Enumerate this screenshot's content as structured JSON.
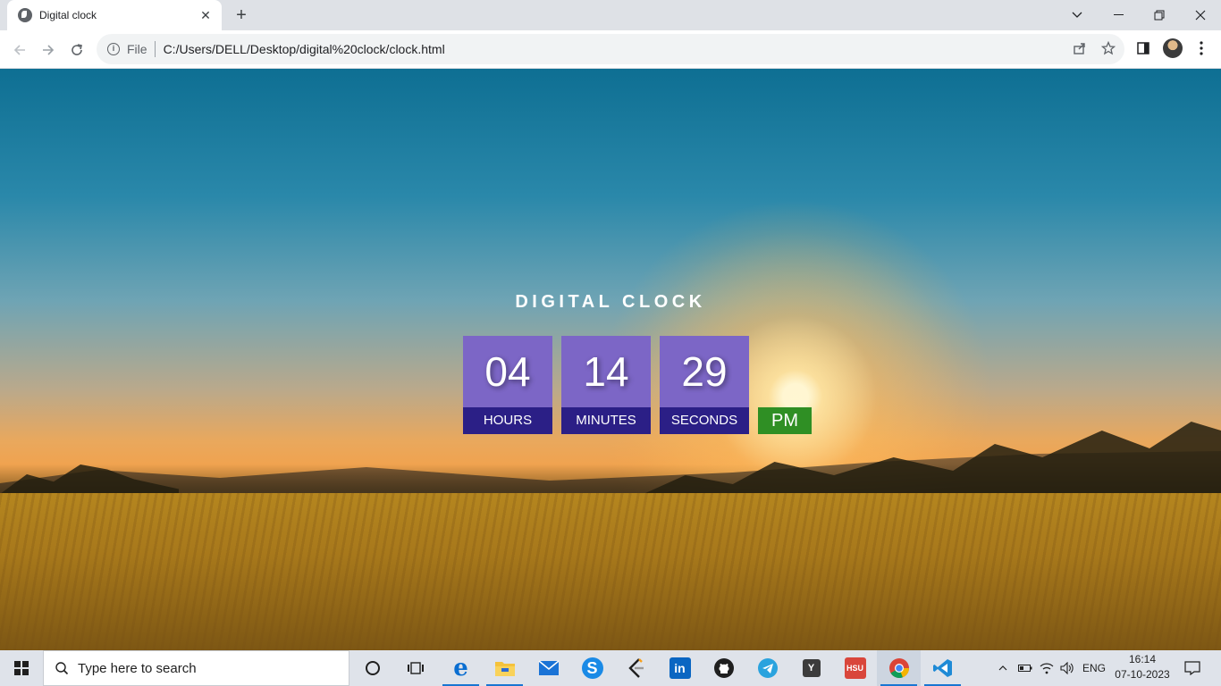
{
  "browser": {
    "tab_title": "Digital clock",
    "tab_close": "✕",
    "new_tab": "+",
    "address_scheme": "File",
    "address_url": "C:/Users/DELL/Desktop/digital%20clock/clock.html",
    "window_controls": {
      "dropdown": "⌄",
      "minimize": "—",
      "restore": "❐",
      "close": "✕"
    },
    "nav": {
      "back": "←",
      "forward": "→",
      "reload": "↻"
    },
    "toolbar_icons": {
      "share": "⇪",
      "bookmark": "☆",
      "side_panel": "◨",
      "menu": "⋮"
    }
  },
  "page": {
    "clock_title": "DIGITAL CLOCK",
    "clock": {
      "hours": "04",
      "minutes": "14",
      "seconds": "29",
      "hours_label": "HOURS",
      "minutes_label": "MINUTES",
      "seconds_label": "SECONDS",
      "ampm": "PM"
    },
    "colors": {
      "digit_box": "#7c66c6",
      "label_box": "#2b1f86",
      "ampm_box": "#2f8f24"
    }
  },
  "taskbar": {
    "search_placeholder": "Type here to search",
    "apps": [
      "cortana-icon",
      "task-view-icon",
      "edge-icon",
      "file-explorer-icon",
      "mail-icon",
      "skype-icon",
      "leetcode-icon",
      "linkedin-icon",
      "github-icon",
      "telegram-icon",
      "ycombinator-icon",
      "hsu-app-icon",
      "chrome-icon",
      "vscode-icon"
    ],
    "tray": {
      "chevron": "^",
      "language": "ENG",
      "time": "16:14",
      "date": "07-10-2023"
    }
  }
}
